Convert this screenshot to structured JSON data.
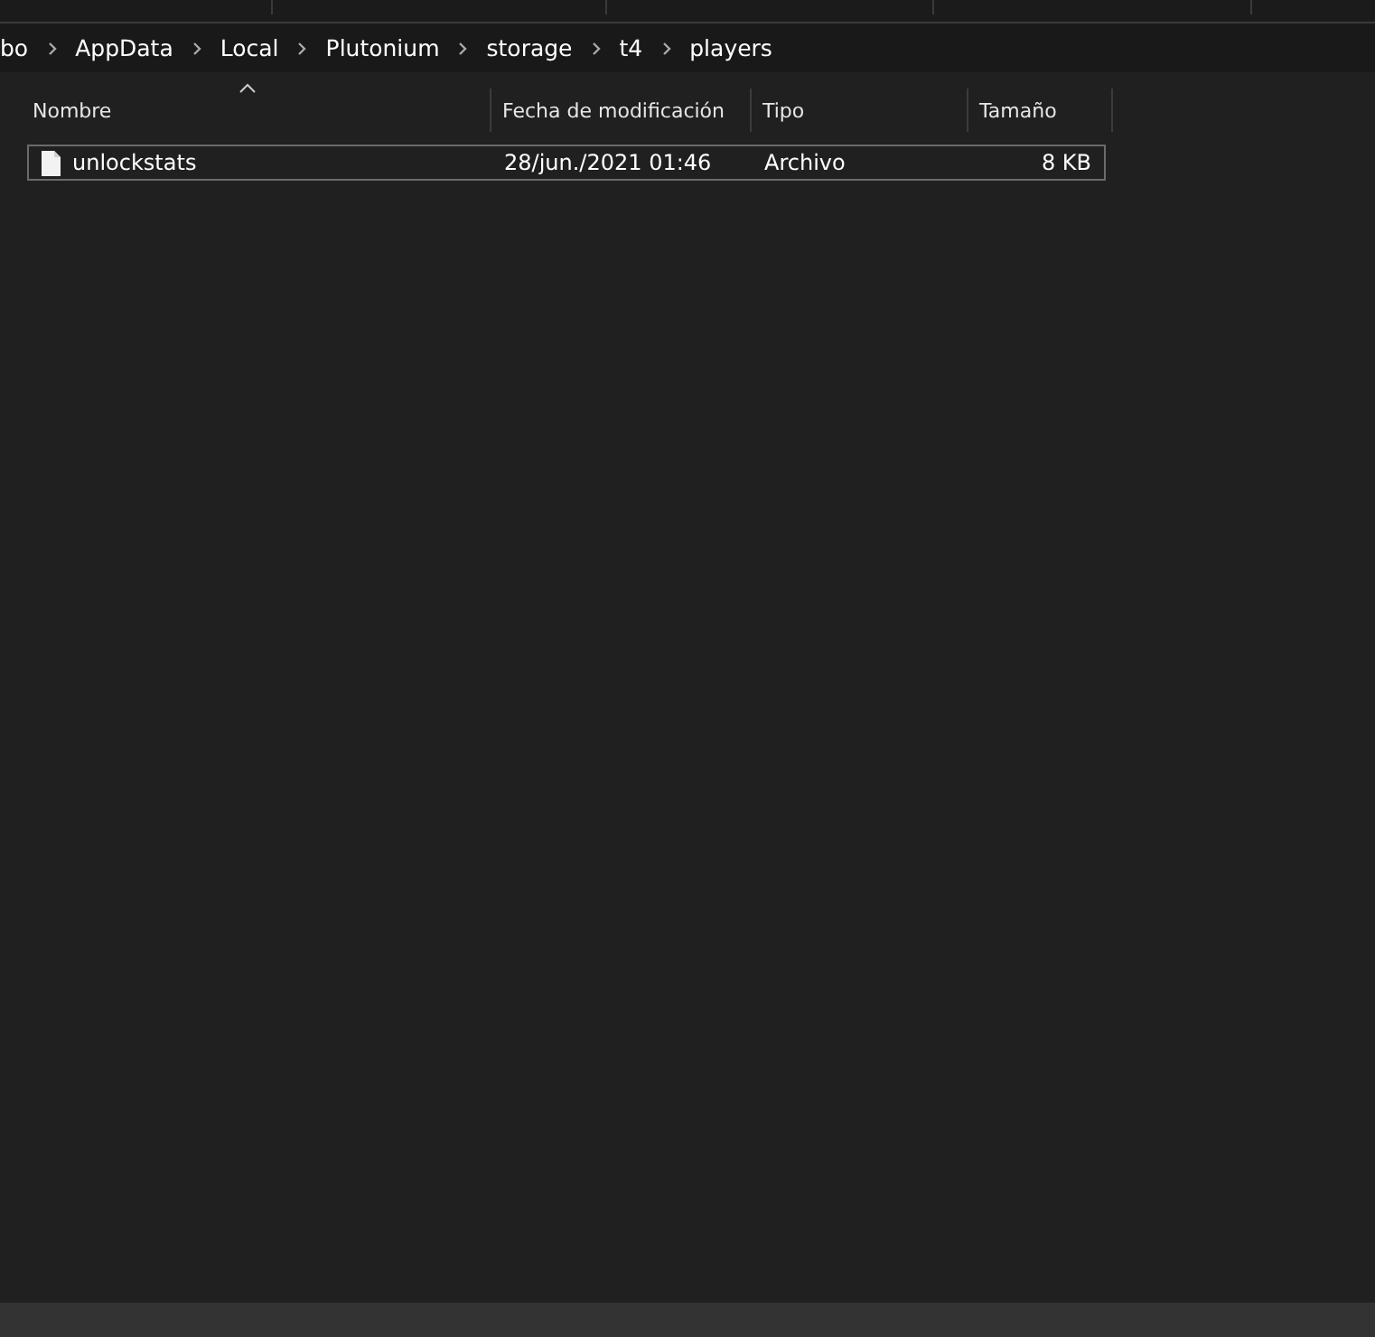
{
  "breadcrumb": [
    "bo",
    "AppData",
    "Local",
    "Plutonium",
    "storage",
    "t4",
    "players"
  ],
  "table": {
    "columns": [
      {
        "label": "Nombre",
        "sorted": true
      },
      {
        "label": "Fecha de modificación",
        "sorted": false
      },
      {
        "label": "Tipo",
        "sorted": false
      },
      {
        "label": "Tamaño",
        "sorted": false
      }
    ],
    "rows": [
      {
        "selected": true,
        "cells": [
          "unlockstats",
          "28/jun./2021 01:46",
          "Archivo",
          "8 KB"
        ]
      }
    ]
  }
}
